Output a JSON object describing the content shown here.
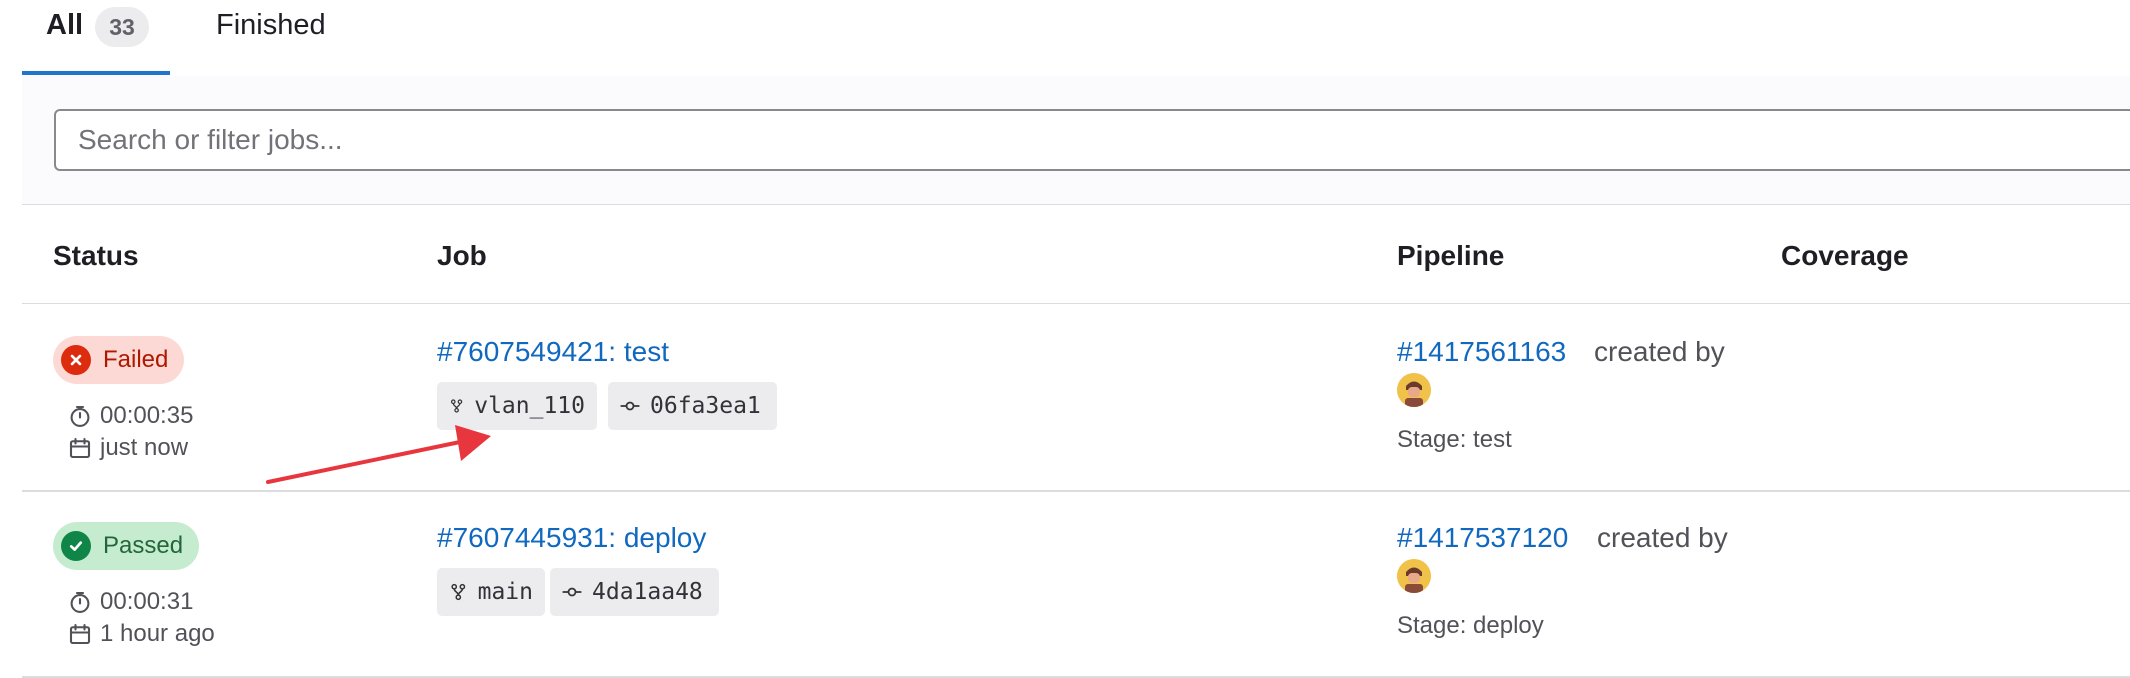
{
  "tabs": {
    "all": {
      "label": "All",
      "count": "33"
    },
    "finished": {
      "label": "Finished"
    }
  },
  "search": {
    "placeholder": "Search or filter jobs...",
    "value": ""
  },
  "table": {
    "headers": {
      "status": "Status",
      "job": "Job",
      "pipeline": "Pipeline",
      "coverage": "Coverage"
    },
    "rows": [
      {
        "status": "Failed",
        "duration": "00:00:35",
        "finished": "just now",
        "job_link": "#7607549421: test",
        "branch": "vlan_110",
        "commit": "06fa3ea1",
        "pipeline_link": "#1417561163",
        "created_by": "created by",
        "stage": "Stage: test"
      },
      {
        "status": "Passed",
        "duration": "00:00:31",
        "finished": "1 hour ago",
        "job_link": "#7607445931: deploy",
        "branch": "main",
        "commit": "4da1aa48",
        "pipeline_link": "#1417537120",
        "created_by": "created by",
        "stage": "Stage: deploy"
      }
    ]
  },
  "icons": {
    "failed": "close-circle-icon",
    "passed": "check-circle-icon",
    "duration": "timer-icon",
    "date": "calendar-icon",
    "branch": "branch-icon",
    "commit": "commit-icon"
  },
  "colors": {
    "link": "#1068bf",
    "failed_bg": "#fcd9d4",
    "failed_text": "#ae1800",
    "passed_bg": "#c6eccf",
    "passed_text": "#24663b",
    "annotation_arrow": "#e8363f"
  }
}
